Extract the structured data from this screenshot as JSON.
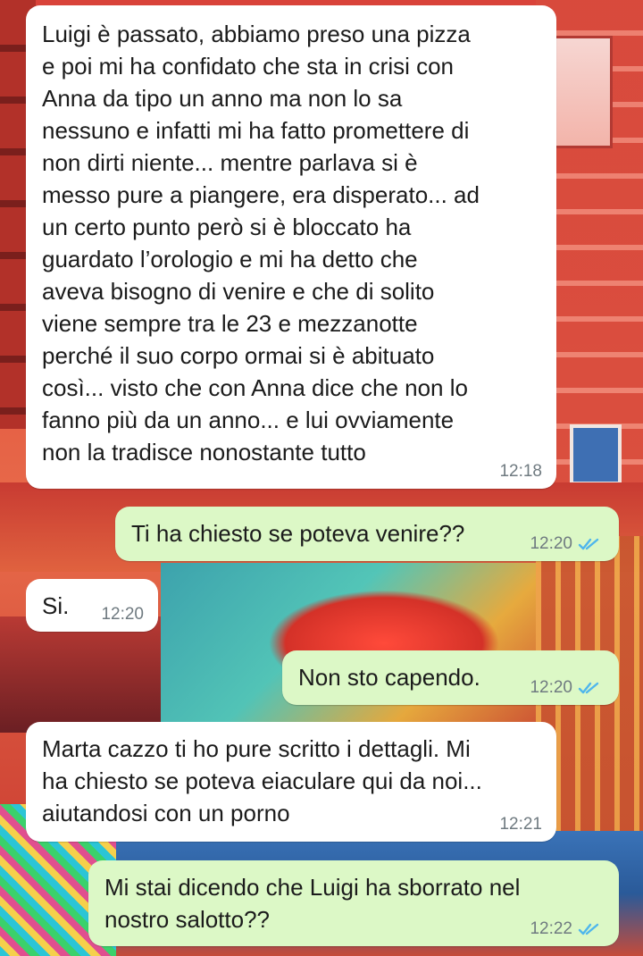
{
  "messages": [
    {
      "direction": "incoming",
      "text": "Luigi è passato, abbiamo preso una pizza\ne poi mi ha confidato che sta in crisi con\nAnna da tipo un anno ma non lo sa\nnessuno e infatti mi ha fatto promettere di\nnon dirti niente... mentre parlava si è\nmesso pure a piangere, era disperato... ad\nun certo punto però si è bloccato ha\nguardato l’orologio e mi ha detto che\naveva bisogno di venire e che di solito\nviene sempre tra le 23 e mezzanotte\nperché il suo corpo ormai si è abituato\ncosì... visto che con Anna dice che non lo\nfanno più da un anno... e lui ovviamente\nnon la tradisce nonostante tutto",
      "time": "12:18"
    },
    {
      "direction": "outgoing",
      "text": "Ti ha chiesto se poteva venire??",
      "time": "12:20",
      "status_icon": "double-check-read-icon"
    },
    {
      "direction": "incoming",
      "text": "Si.",
      "time": "12:20"
    },
    {
      "direction": "outgoing",
      "text": "Non sto capendo.",
      "time": "12:20",
      "status_icon": "double-check-read-icon"
    },
    {
      "direction": "incoming",
      "text": "Marta cazzo ti ho pure scritto i dettagli. Mi\nha chiesto se poteva eiaculare qui da noi...\naiutandosi con un porno",
      "time": "12:21"
    },
    {
      "direction": "outgoing",
      "text": "Mi stai dicendo che Luigi ha sborrato nel\nnostro salotto??",
      "time": "12:22",
      "status_icon": "double-check-read-icon"
    }
  ],
  "colors": {
    "incoming_bubble": "#ffffff",
    "outgoing_bubble": "#dcf8c6",
    "read_ticks": "#4fb6ec",
    "timestamp": "#6f7a80"
  }
}
